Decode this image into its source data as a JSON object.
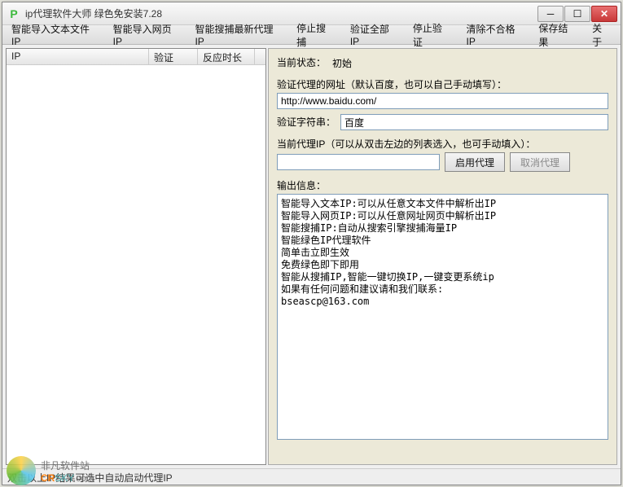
{
  "window": {
    "title": "ip代理软件大师 绿色免安装7.28"
  },
  "menu": {
    "items": [
      "智能导入文本文件IP",
      "智能导入网页IP",
      "智能搜捕最新代理IP",
      "停止搜捕",
      "验证全部IP",
      "停止验证",
      "清除不合格IP",
      "保存结果",
      "关于"
    ]
  },
  "listview": {
    "columns": [
      "IP",
      "验证",
      "反应时长"
    ]
  },
  "right": {
    "status_label": "当前状态：",
    "status_value": "初始",
    "verify_url_label": "验证代理的网址（默认百度，也可以自己手动填写）：",
    "verify_url_value": "http://www.baidu.com/",
    "verify_string_label": "验证字符串：",
    "verify_string_value": "百度",
    "proxy_label": "当前代理IP（可以从双击左边的列表选入，也可手动填入）：",
    "proxy_value": "",
    "btn_enable": "启用代理",
    "btn_cancel": "取消代理",
    "output_label": "输出信息：",
    "output_text": "智能导入文本IP:可以从任意文本文件中解析出IP\n智能导入网页IP:可以从任意网址网页中解析出IP\n智能搜捕IP:自动从搜索引擎搜捕海量IP\n智能绿色IP代理软件\n简单击立即生效\n免费绿色即下即用\n智能从搜捕IP,智能一键切换IP,一键变更系统ip\n如果有任何问题和建议请和我们联系:\nbseascp@163.com"
  },
  "statusbar": "双击以上IP结果可选中自动启动代理IP",
  "watermark": {
    "brand": "非凡软件站",
    "url": "CRSKY.com"
  }
}
